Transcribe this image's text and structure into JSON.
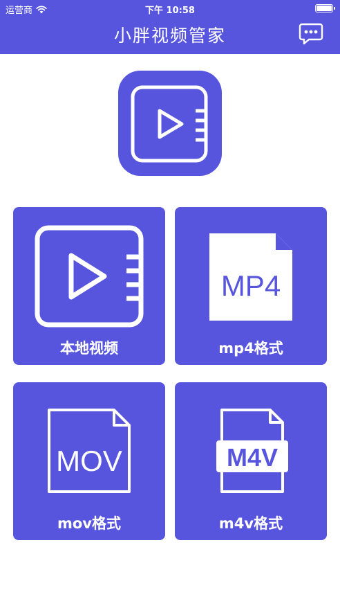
{
  "status_bar": {
    "carrier": "运营商",
    "time": "下午 10:58"
  },
  "header": {
    "title": "小胖视频管家",
    "chat_icon": "chat-bubble-icon"
  },
  "hero": {
    "icon": "video-play-icon"
  },
  "tiles": [
    {
      "label": "本地视频",
      "icon": "video-play-icon"
    },
    {
      "label": "mp4格式",
      "icon": "mp4-file-icon",
      "file_text": "MP4"
    },
    {
      "label": "mov格式",
      "icon": "mov-file-icon",
      "file_text": "MOV"
    },
    {
      "label": "m4v格式",
      "icon": "m4v-file-icon",
      "file_text": "M4V"
    }
  ],
  "colors": {
    "accent": "#5755dd",
    "background": "#ffffff",
    "icon_foreground": "#ffffff"
  }
}
